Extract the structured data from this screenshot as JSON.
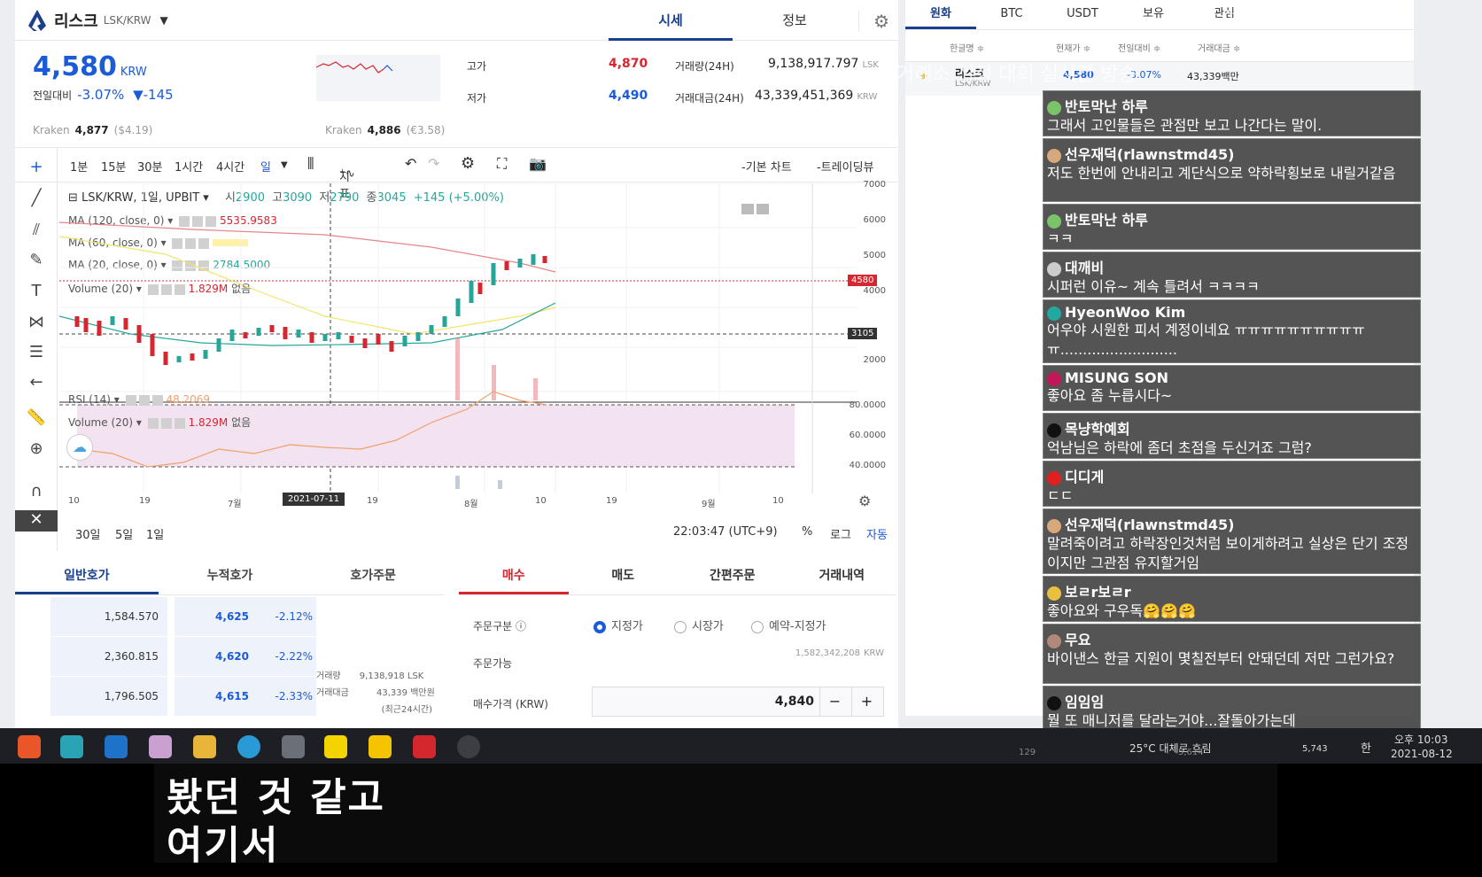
{
  "header": {
    "coin_name": "리스크",
    "coin_pair": "LSK/KRW",
    "tabs": [
      "시세",
      "정보"
    ]
  },
  "price": {
    "current": "4,580",
    "unit": "KRW",
    "change_label": "전일대비",
    "change_pct": "-3.07%",
    "change_abs": "▼-145"
  },
  "stats": {
    "high_label": "고가",
    "high": "4,870",
    "low_label": "저가",
    "low": "4,490",
    "vol_label": "거래량(24H)",
    "vol": "9,138,917.797",
    "vol_unit": "LSK",
    "amt_label": "거래대금(24H)",
    "amt": "43,339,451,369",
    "amt_unit": "KRW"
  },
  "kraken": [
    {
      "name": "Kraken",
      "price": "4,877",
      "conv": "($4.19)"
    },
    {
      "name": "Kraken",
      "price": "4,886",
      "conv": "(€3.58)"
    }
  ],
  "chart_toolbar": {
    "intervals": [
      "1분",
      "15분",
      "30분",
      "1시간",
      "4시간",
      "일"
    ],
    "indicator": "지표",
    "basic_chart": "-기본 차트",
    "trading_view": "-트레이딩뷰"
  },
  "chart_legend": {
    "symbol": "LSK/KRW, 1일, UPBIT",
    "open_label": "시",
    "open": "2900",
    "high_label": "고",
    "high": "3090",
    "low_label": "저",
    "low": "2790",
    "close_label": "종",
    "close": "3045",
    "change": "+145 (+5.00%)",
    "ma120": "MA (120, close, 0)",
    "ma120_val": "5535.9583",
    "ma60": "MA (60, close, 0)",
    "ma20": "MA (20, close, 0)",
    "ma20_val": "2784.5000",
    "volume": "Volume (20)",
    "volume_val": "1.829M",
    "volume_extra": "없음",
    "rsi": "RSI (14)",
    "rsi_val": "48.2069",
    "volume2": "Volume (20)",
    "volume2_val": "1.829M",
    "volume2_extra": "없음"
  },
  "chart_axes": {
    "y_labels": [
      "7000",
      "6000",
      "5000",
      "4000",
      "2000"
    ],
    "price_tag": "4580",
    "cross_tag": "3105",
    "rsi_labels": [
      "80.0000",
      "60.0000",
      "40.0000"
    ],
    "x_labels": [
      "10",
      "19",
      "7월",
      "19",
      "8월",
      "10",
      "19",
      "9월",
      "10"
    ],
    "x_cursor": "2021-07-11"
  },
  "chart_bottom": {
    "ranges": [
      "30일",
      "5일",
      "1일"
    ],
    "time": "22:03:47 (UTC+9)",
    "pct": "%",
    "log": "로그",
    "auto": "자동"
  },
  "orderbook": {
    "tabs": [
      "일반호가",
      "누적호가",
      "호가주문"
    ],
    "rows": [
      {
        "vol": "1,584.570",
        "price": "4,625",
        "pct": "-2.12%"
      },
      {
        "vol": "2,360.815",
        "price": "4,620",
        "pct": "-2.22%"
      },
      {
        "vol": "1,796.505",
        "price": "4,615",
        "pct": "-2.33%"
      }
    ],
    "side_vol_label": "거래량",
    "side_vol": "9,138,918",
    "side_vol_unit": "LSK",
    "side_amt_label": "거래대금",
    "side_amt": "43,339",
    "side_amt_unit": "백만원",
    "side_note": "(최근24시간)"
  },
  "order": {
    "tabs": [
      "매수",
      "매도",
      "간편주문",
      "거래내역"
    ],
    "type_label": "주문구분",
    "types": [
      "지정가",
      "시장가",
      "예약-지정가"
    ],
    "avail_label": "주문가능",
    "avail": "1,582,342,208",
    "avail_unit": "KRW",
    "price_label": "매수가격 (KRW)",
    "price_value": "4,840",
    "minus": "−",
    "plus": "+"
  },
  "watchlist": {
    "tabs": [
      "원화",
      "BTC",
      "USDT",
      "보유",
      "관심"
    ],
    "cols": [
      "한글명 ≑",
      "현재가 ≑",
      "전일대비 ≑",
      "거래대금 ≑"
    ],
    "row": {
      "name": "리스크",
      "pair": "LSK/KRW",
      "price": "4,580",
      "pct": "-3.07%",
      "amt": "43,339백만"
    }
  },
  "overlay_texts": [
    "세계 1위(팀전)",
    "거래소 선정 대회 실시간 방송"
  ],
  "chat": [
    {
      "name": "반토막난 하루",
      "text": "그래서 고인물들은 관점만 보고 나간다는 말이.",
      "color": "#7ac36a"
    },
    {
      "name": "선우재덕(rlawnstmd45)",
      "text": "저도 한번에 안내리고 계단식으로 약하락횡보로 내릴거같음",
      "color": "#d9a87a"
    },
    {
      "name": "반토막난 하루",
      "text": "ㅋㅋ",
      "color": "#7ac36a"
    },
    {
      "name": "대깨비",
      "text": "시퍼런 이유~ 계속 틀려서 ㅋㅋㅋㅋ",
      "color": "#cccccc"
    },
    {
      "name": "HyeonWoo Kim",
      "text": "어우야 시원한 피서 계정이네요 ㅠㅠㅠㅠㅠㅠㅠㅠㅠㅠ ㅠ..........................",
      "color": "#22a8a0"
    },
    {
      "name": "MISUNG SON",
      "text": "좋아요 좀 누릅시다~",
      "color": "#c2185b"
    },
    {
      "name": "목냥학예회",
      "text": "억남님은 하락에 좀더 초점을 두신거죠 그럼?",
      "color": "#111111"
    },
    {
      "name": "디디게",
      "text": "ㄷㄷ",
      "color": "#e02020"
    },
    {
      "name": "선우재덕(rlawnstmd45)",
      "text": "말려죽이려고 하락장인것처럼 보이게하려고 실상은 단기 조정이지만 그관점 유지할거임",
      "color": "#d9a87a"
    },
    {
      "name": "보ㄹr보ㄹr",
      "text": "좋아요와 구우독🤗🤗🤗",
      "color": "#e8c040"
    },
    {
      "name": "무요",
      "text": "바이낸스 한글 지원이 몇칠전부터 안돼던데 저만 그런가요?",
      "color": "#b0897a"
    },
    {
      "name": "임임임",
      "text": "뭘 또 매니저를 달라는거야...잘돌아가는데",
      "color": "#111111"
    }
  ],
  "taskbar": {
    "weather": "25°C  대체로 흐림",
    "viewer": "5,743",
    "lang": "한",
    "time": "오후 10:03",
    "date": "2021-08-12",
    "extra1": "129",
    "extra2": "5,614"
  },
  "subtitles": [
    "봤던 것 같고",
    "여기서"
  ],
  "chart_data": {
    "type": "line",
    "title": "",
    "series": [
      {
        "name": "price",
        "values": [
          3200,
          3000,
          2850,
          2400,
          2300,
          2500,
          2950,
          3050,
          2900,
          2850,
          3000,
          2750,
          2700,
          2950,
          3000,
          3100,
          3400,
          3800,
          4100,
          4400,
          4700,
          4800,
          4580
        ]
      }
    ],
    "ylim": [
      1500,
      7000
    ]
  }
}
